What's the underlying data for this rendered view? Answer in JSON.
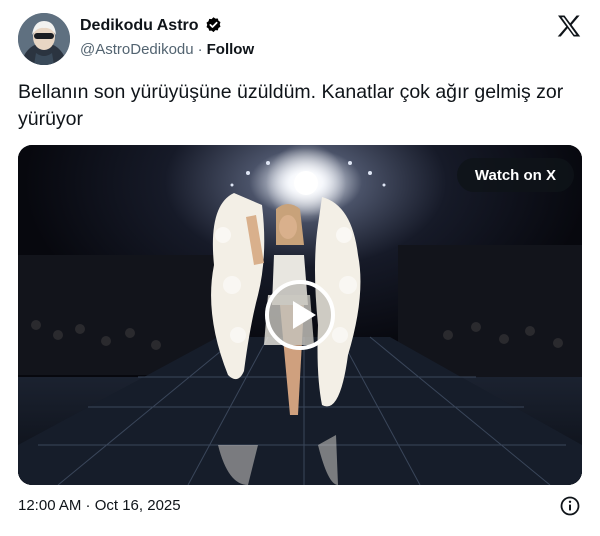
{
  "author": {
    "display_name": "Dedikodu Astro",
    "handle": "@AstroDedikodu",
    "separator": "·",
    "follow_label": "Follow",
    "verified": true
  },
  "tweet": {
    "text": "Bellanın son yürüyüşüne üzüldüm. Kanatlar çok ağır gelmiş zor yürüyor",
    "timestamp": "12:00 AM · Oct 16, 2025"
  },
  "media": {
    "type": "video",
    "watch_label": "Watch on X"
  },
  "icons": {
    "brand": "x-logo-icon",
    "verified": "verified-badge-icon",
    "play": "play-icon",
    "info": "info-icon"
  },
  "colors": {
    "text": "#0f1419",
    "secondary_text": "#536471",
    "verified_badge": "#000000"
  }
}
